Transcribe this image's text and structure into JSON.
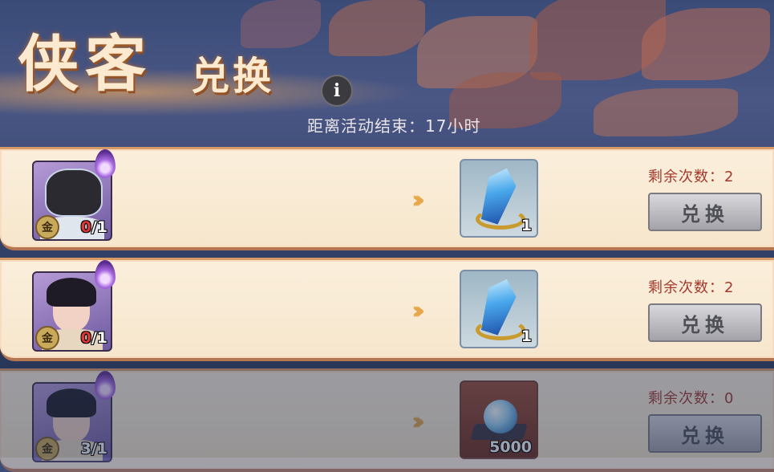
{
  "header": {
    "title_main": "侠客",
    "title_sub": "兑换",
    "info_glyph": "i",
    "countdown": "距离活动结束：17小时"
  },
  "rows": [
    {
      "hero": "masked-warrior",
      "rank_badge": "金",
      "owned": "0",
      "required": "/1",
      "reward": "blue-crystal",
      "reward_qty": "1",
      "remaining": "剩余次数：2",
      "button": "兑换"
    },
    {
      "hero": "scholar",
      "rank_badge": "金",
      "owned": "0",
      "required": "/1",
      "reward": "blue-crystal",
      "reward_qty": "1",
      "remaining": "剩余次数：2",
      "button": "兑换"
    },
    {
      "hero": "lady",
      "rank_badge": "金",
      "owned": "3",
      "required": "/1",
      "reward": "crystal-orb",
      "reward_qty": "5000",
      "remaining": "剩余次数：0",
      "button": "兑换"
    }
  ],
  "colors": {
    "row_bg": "#f6e6cc",
    "remaining_text": "#a4382c",
    "arrow": "#e6a84a",
    "shortage": "#e03636"
  }
}
